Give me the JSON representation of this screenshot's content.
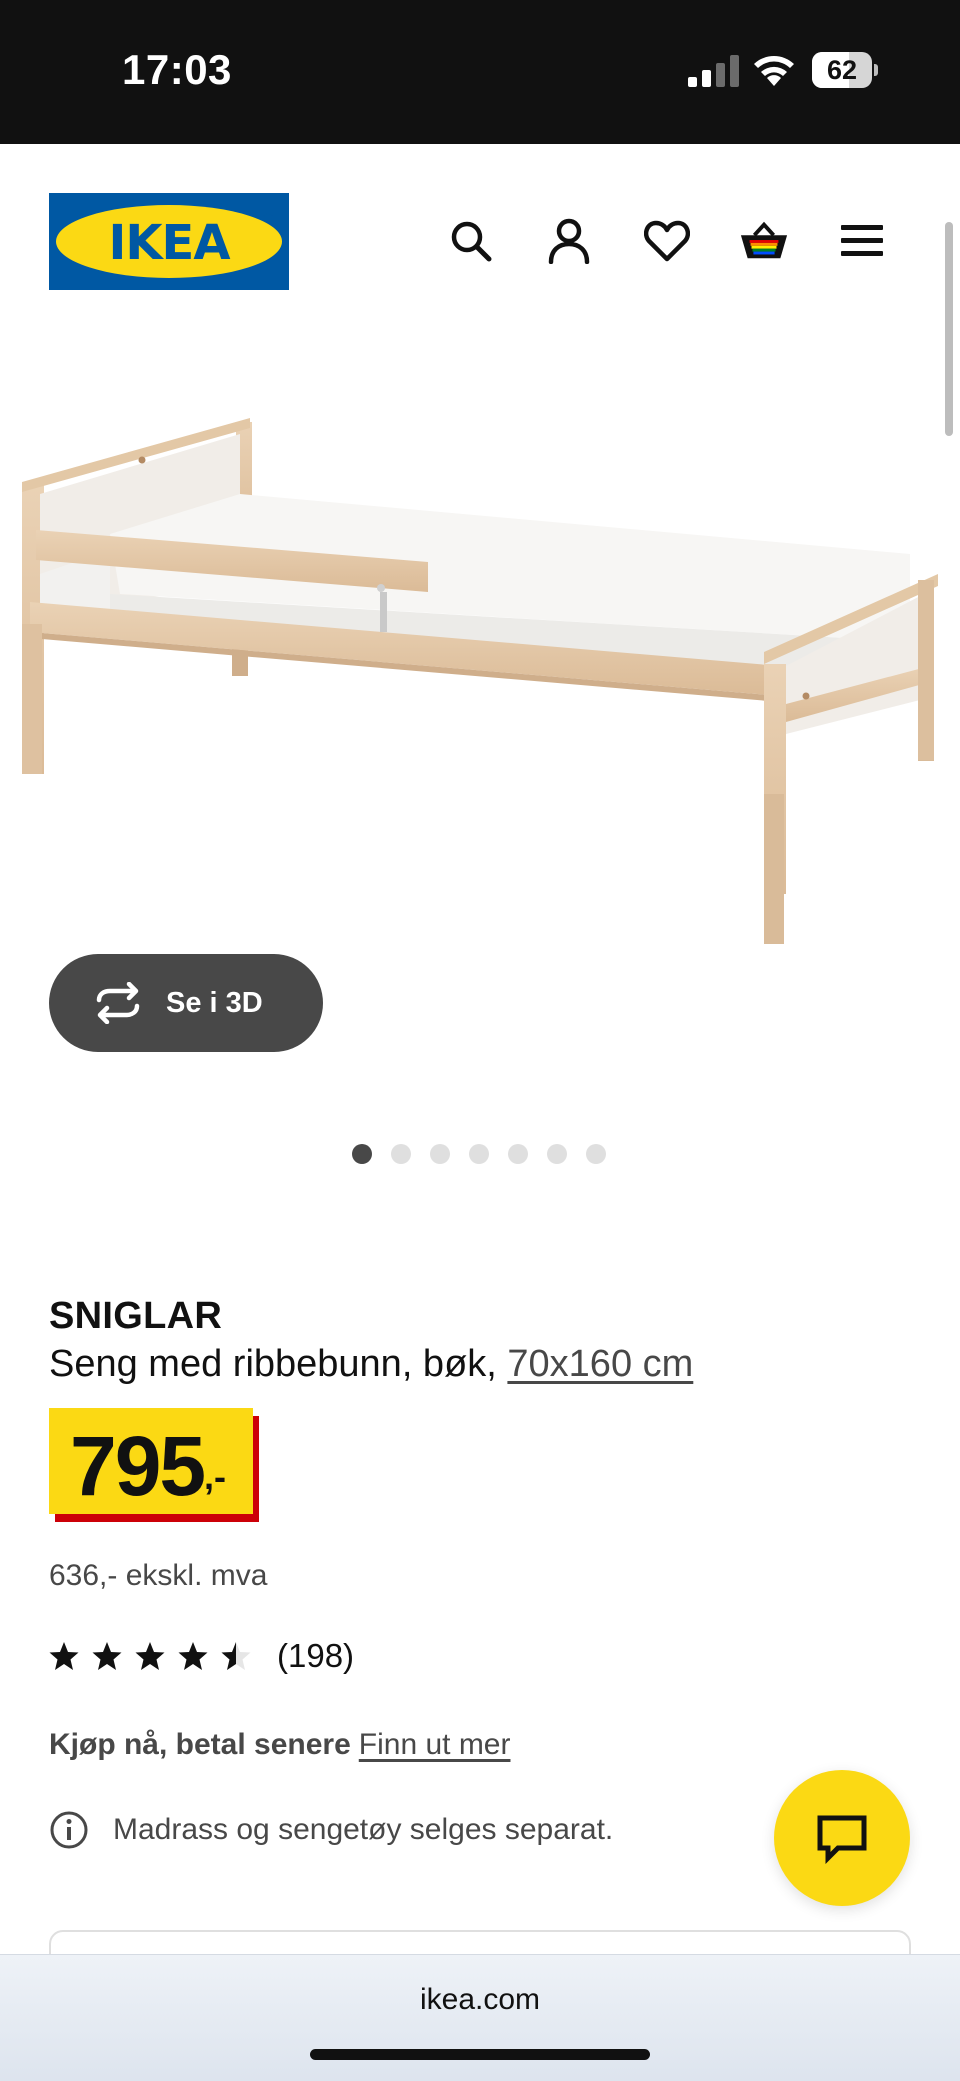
{
  "status_bar": {
    "time": "17:03",
    "battery_percent": "62"
  },
  "header": {
    "logo_text": "IKEA",
    "icons": [
      "search-icon",
      "profile-icon",
      "heart-icon",
      "basket-icon",
      "menu-icon"
    ]
  },
  "gallery": {
    "view_3d_label": "Se i 3D",
    "image_count": 7,
    "active_index": 0
  },
  "product": {
    "name": "SNIGLAR",
    "description": "Seng med ribbebunn, bøk, ",
    "size_link": "70x160 cm",
    "price_integer": "795",
    "price_decimal": ",-",
    "price_ex_vat": "636,- ekskl. mva",
    "rating": 4.5,
    "review_count": "(198)",
    "bnpl_bold": "Kjøp nå, betal senere",
    "bnpl_link": "Finn ut mer",
    "notice": "Madrass og sengetøy selges separat."
  },
  "browser": {
    "url": "ikea.com"
  },
  "colors": {
    "ikea_blue": "#0058a3",
    "ikea_yellow": "#fbd914",
    "price_red": "#cc0008",
    "button_dark": "#484848"
  }
}
